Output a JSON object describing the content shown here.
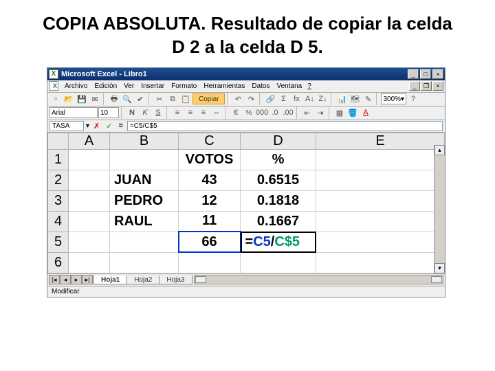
{
  "slide": {
    "title": "COPIA ABSOLUTA. Resultado de copiar la celda D 2 a la celda D 5."
  },
  "window": {
    "title": "Microsoft Excel - Libro1"
  },
  "menus": [
    "Archivo",
    "Edición",
    "Ver",
    "Insertar",
    "Formato",
    "Herramientas",
    "Datos",
    "Ventana",
    "?"
  ],
  "nameBox": "TASA",
  "formulaBar": "=C5/C$5",
  "toolbar": {
    "copyLabel": "Copiar",
    "zoom": "300%"
  },
  "format": {
    "font": "Arial",
    "size": "10"
  },
  "columns": [
    "",
    "A",
    "B",
    "C",
    "D",
    "E"
  ],
  "rows": [
    {
      "n": "1",
      "A": "",
      "B": "",
      "C": "VOTOS",
      "D": "%",
      "E": ""
    },
    {
      "n": "2",
      "A": "",
      "B": "JUAN",
      "C": "43",
      "D": "0.6515",
      "E": ""
    },
    {
      "n": "3",
      "A": "",
      "B": "PEDRO",
      "C": "12",
      "D": "0.1818",
      "E": ""
    },
    {
      "n": "4",
      "A": "",
      "B": "RAUL",
      "C": "11",
      "D": "0.1667",
      "E": ""
    },
    {
      "n": "5",
      "A": "",
      "B": "",
      "C": "66",
      "D_formula": {
        "eq": "=",
        "ref1": "C5",
        "slash": "/",
        "ref2": "C$5"
      },
      "E": ""
    },
    {
      "n": "6",
      "A": "",
      "B": "",
      "C": "",
      "D": "",
      "E": ""
    }
  ],
  "sheets": [
    "Hoja1",
    "Hoja2",
    "Hoja3"
  ],
  "status": "Modificar"
}
